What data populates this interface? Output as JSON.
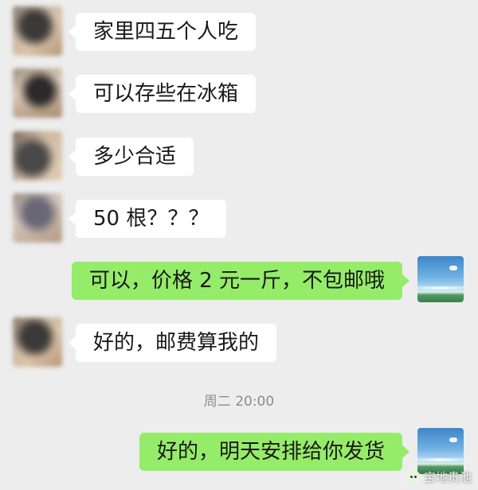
{
  "messages": [
    {
      "side": "left",
      "text": "家里四五个人吃"
    },
    {
      "side": "left",
      "text": "可以存些在冰箱"
    },
    {
      "side": "left",
      "text": "多少合适"
    },
    {
      "side": "left",
      "text": "50 根？？？"
    },
    {
      "side": "right",
      "text": "可以，价格 2 元一斤，不包邮哦"
    },
    {
      "side": "left",
      "text": "好的，邮费算我的"
    },
    {
      "side": "right",
      "text": "好的，明天安排给你发货"
    }
  ],
  "timestamp": "周二 20:00",
  "watermark": {
    "text": "宝地贵池",
    "icon": "wechat-icon"
  },
  "colors": {
    "background": "#ededed",
    "incoming_bubble": "#ffffff",
    "outgoing_bubble": "#95ec69",
    "timestamp_text": "#8c8c8c"
  }
}
